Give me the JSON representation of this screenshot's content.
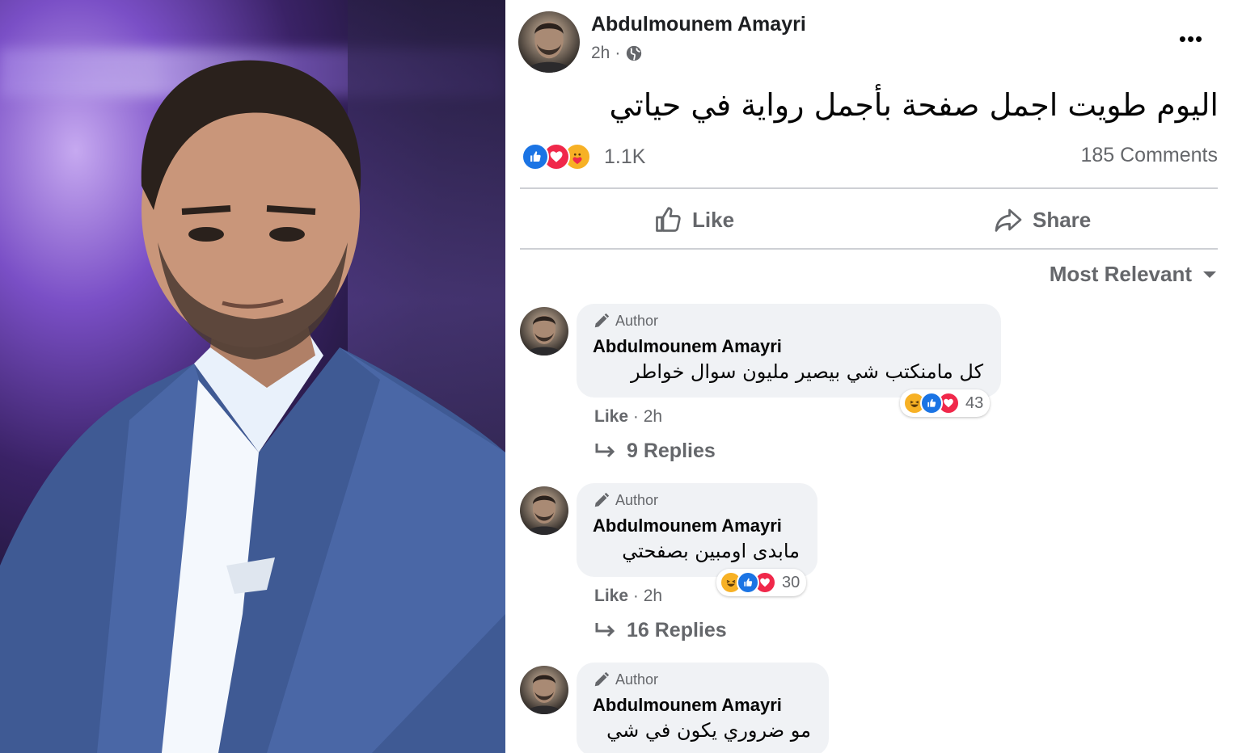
{
  "post": {
    "author": "Abdulmounem Amayri",
    "time": "2h",
    "separator": "·",
    "text": "اليوم طويت اجمل صفحة بأجمل رواية في حياتي",
    "reaction_count": "1.1K",
    "comments_count": "185 Comments",
    "reactions": [
      "like",
      "love",
      "care"
    ]
  },
  "actions": {
    "like_label": "Like",
    "share_label": "Share"
  },
  "sort": {
    "label": "Most Relevant"
  },
  "comments": [
    {
      "tag": "Author",
      "name": "Abdulmounem Amayri",
      "text": "كل مامنكتب شي بيصير مليون سوال خواطر",
      "reaction_count": "43",
      "like": "Like",
      "time": "· 2h",
      "replies": "9 Replies"
    },
    {
      "tag": "Author",
      "name": "Abdulmounem Amayri",
      "text": "مابدى اومبين بصفحتي",
      "reaction_count": "30",
      "like": "Like",
      "time": "· 2h",
      "replies": "16 Replies"
    },
    {
      "tag": "Author",
      "name": "Abdulmounem Amayri",
      "text": "مو ضروري يكون في شي"
    }
  ],
  "colors": {
    "facebook_blue": "#1b74e4",
    "love_red": "#f0284a",
    "care_yellow": "#f7b125",
    "secondary_text": "#65676b",
    "bubble_bg": "#f0f2f5"
  },
  "icons": [
    "globe-icon",
    "more-icon",
    "like-thumb-icon",
    "share-arrow-icon",
    "caret-down-icon",
    "pencil-icon",
    "reply-arrow-icon"
  ]
}
